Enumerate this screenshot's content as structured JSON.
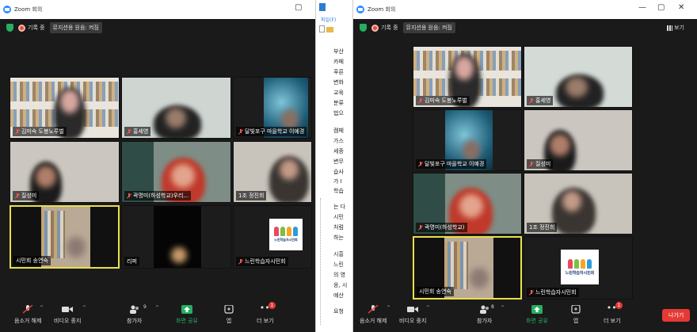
{
  "left": {
    "title": "Zoom 회의",
    "rec": "기록 중",
    "view_pill": "뮤지션용 원음: 켜짐",
    "tiles": [
      "김미숙 도봉노루벌",
      "홍세영",
      "달빛포구 마을학교 이예경",
      "질성미",
      "곽명미(하성학교)우리...",
      "1조 정진희",
      "시민회 송연숙",
      "리퍼",
      "느린학습자시민회"
    ],
    "toolbar": {
      "audio": "음소거 해제",
      "video": "비디오 중지",
      "participants": "참가자",
      "participants_count": "9",
      "share": "화면 공유",
      "apps": "앱",
      "more": "더 보기",
      "more_badge": "1"
    }
  },
  "right": {
    "title": "Zoom 회의",
    "rec": "기록 중",
    "view_pill": "뮤지션용 원음: 켜짐",
    "view_btn": "보기",
    "tiles": [
      "김미숙 도봉노루벌",
      "홍세영",
      "달빛포구 마을학교 이예경",
      "질성미",
      "곽명미(하성학교)",
      "1조 정진희",
      "시민회 송연숙",
      "느린학습자시민회"
    ],
    "toolbar": {
      "audio": "음소거 해제",
      "video": "비디오 중지",
      "participants": "참가자",
      "participants_count": "8",
      "share": "화면 공유",
      "apps": "앱",
      "more": "더 보기",
      "more_badge": "1",
      "leave": "나가기"
    }
  },
  "doc": {
    "menu": "파일(F)",
    "lines": [
      "부산",
      "카페",
      "푸른",
      "변화",
      "교육",
      "분류",
      "법으",
      "캠페",
      "가스",
      "세종",
      "변무",
      "습사",
      "가 I",
      "학습",
      "는 다",
      "시민",
      "처럼",
      "하는",
      "시흥",
      "느린",
      "의 영",
      "응, 시",
      "예산",
      "요청"
    ]
  },
  "logo_text": "느린학습자시민회"
}
